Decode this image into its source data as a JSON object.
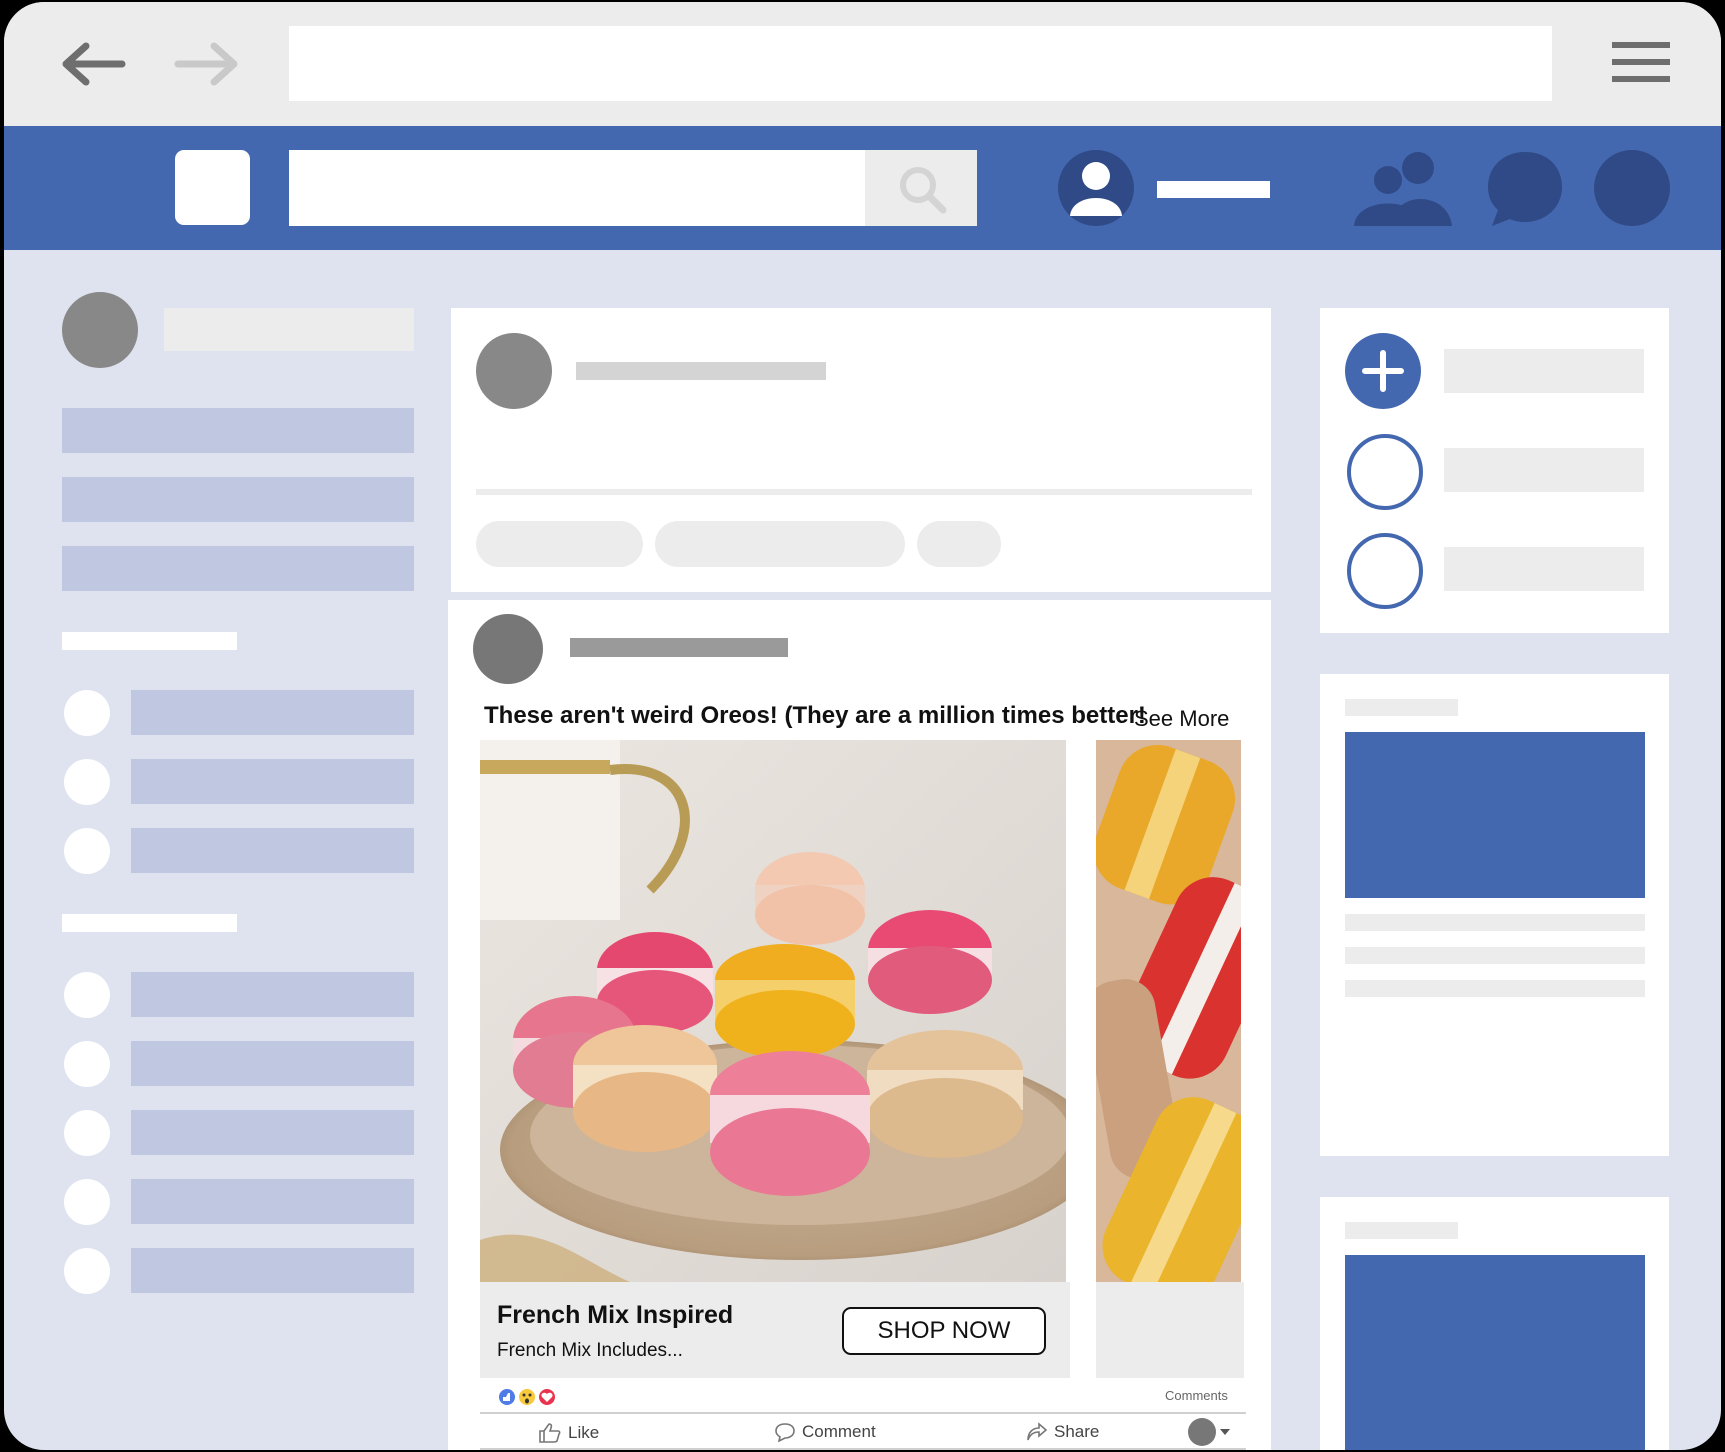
{
  "post": {
    "headline": "These aren't weird Oreos! (They are a million times better!",
    "see_more": "See More",
    "carousel": {
      "card_title": "French Mix Inspired",
      "card_subtitle": "French Mix Includes...",
      "cta": "SHOP NOW"
    },
    "comments_label": "Comments",
    "actions": {
      "like": "Like",
      "comment": "Comment",
      "share": "Share"
    }
  },
  "icons": {
    "back": "arrow-left-icon",
    "forward": "arrow-right-icon",
    "menu": "hamburger-icon",
    "search": "magnifier-icon",
    "profile": "user-icon",
    "friends": "people-icon",
    "messages": "chat-bubble-icon",
    "add": "plus-icon"
  },
  "colors": {
    "brand": "#4468b0",
    "page_bg": "#dfe3ef",
    "placeholder_bar": "#c0c7e0"
  }
}
